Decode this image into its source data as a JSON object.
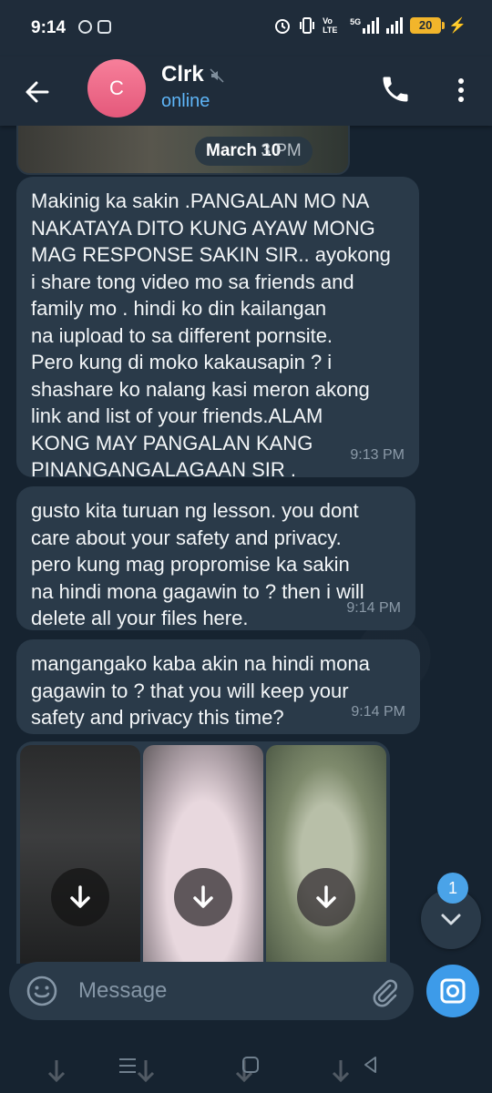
{
  "status_bar": {
    "time": "9:14",
    "network_label": "Vo LTE",
    "network_5g": "5G",
    "battery": "20"
  },
  "header": {
    "avatar_initial": "C",
    "contact_name": "Clrk",
    "status": "online"
  },
  "chat": {
    "date_label": "March 10",
    "date_ghost": "3 PM",
    "messages": [
      {
        "text": "Makinig ka sakin .PANGALAN MO NA\nNAKATAYA DITO KUNG AYAW MONG\nMAG RESPONSE SAKIN SIR.. ayokong\ni share tong video mo sa friends and\nfamily mo . hindi ko din kailangan\nna iupload to sa different pornsite.\nPero kung di moko kakausapin ? i\nshashare ko nalang kasi meron akong\nlink and list of your friends.ALAM\nKONG MAY PANGALAN KANG\nPINANGANGALAGAAN SIR .",
        "time": "9:13 PM"
      },
      {
        "text": "gusto kita turuan ng lesson. you dont\ncare about your safety and privacy.\npero kung mag propromise ka sakin\nna hindi mona gagawin to ? then i will\ndelete all your files here.",
        "time": "9:14 PM"
      },
      {
        "text": "mangangako kaba akin na hindi mona\ngagawin to ? that you will keep your\nsafety and privacy this time?",
        "time": "9:14 PM"
      }
    ],
    "unread_count": "1"
  },
  "composer": {
    "placeholder": "Message"
  },
  "colors": {
    "background": "#162330",
    "bubble": "#2a3a49",
    "header": "#1f2c3a",
    "accent": "#3d9be9",
    "online": "#5eb5f7",
    "avatar": "#e4597b"
  }
}
